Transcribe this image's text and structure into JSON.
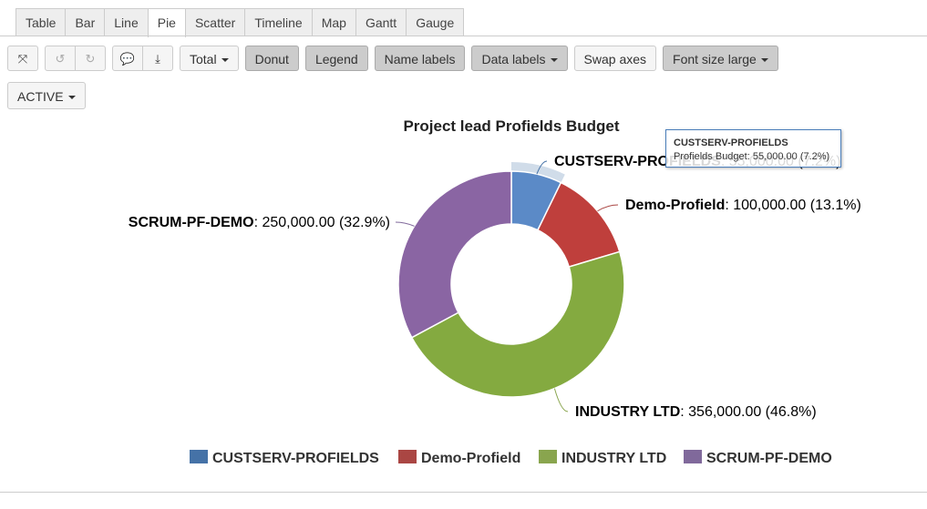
{
  "tabs": [
    "Table",
    "Bar",
    "Line",
    "Pie",
    "Scatter",
    "Timeline",
    "Map",
    "Gantt",
    "Gauge"
  ],
  "active_tab": "Pie",
  "toolbar": {
    "total": "Total",
    "donut": "Donut",
    "legend": "Legend",
    "name_labels": "Name labels",
    "data_labels": "Data labels",
    "swap_axes": "Swap axes",
    "font_size": "Font size large",
    "status": "ACTIVE"
  },
  "icons": [
    "fullscreen-icon",
    "undo-icon",
    "redo-icon",
    "comment-icon",
    "download-icon"
  ],
  "tooltip": {
    "title": "CUSTSERV-PROFIELDS",
    "text": "Profields Budget: 55,000.00 (7.2%)"
  },
  "chart_data": {
    "type": "pie",
    "donut": true,
    "title": "Project lead Profields Budget",
    "series_name": "Profields Budget",
    "categories": [
      "CUSTSERV-PROFIELDS",
      "Demo-Profield",
      "INDUSTRY LTD",
      "SCRUM-PF-DEMO"
    ],
    "values": [
      55000,
      100000,
      356000,
      250000
    ],
    "percents": [
      7.2,
      13.1,
      46.8,
      32.9
    ],
    "value_labels": [
      "55,000.00 (7.2%)",
      "100,000.00 (13.1%)",
      "356,000.00 (46.8%)",
      "250,000.00 (32.9%)"
    ],
    "colors": [
      "#4572a7",
      "#aa4643",
      "#89a54e",
      "#80699b"
    ],
    "hovered": "CUSTSERV-PROFIELDS",
    "legend": "bottom"
  }
}
